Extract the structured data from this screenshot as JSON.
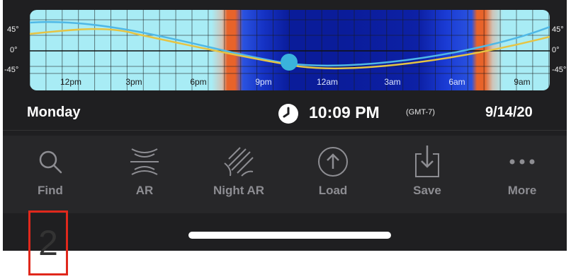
{
  "timeline": {
    "time_labels": [
      "12pm",
      "3pm",
      "6pm",
      "9pm",
      "12am",
      "3am",
      "6am",
      "9am"
    ],
    "altitude_labels_left": [
      "45°",
      "0°",
      "-45°"
    ],
    "altitude_labels_right": [
      "45°",
      "0°",
      "-45°"
    ],
    "colors": {
      "day": "#a8ecf5",
      "twilight_orange": "#e8632a",
      "night_dark": "#0a1c9a",
      "sun_line": "#4fb8e6",
      "moon_line": "#e6c443",
      "cursor": "#3ab3dc"
    }
  },
  "info": {
    "day": "Monday",
    "time": "10:09 PM",
    "timezone": "(GMT-7)",
    "date": "9/14/20"
  },
  "toolbar": {
    "items": [
      {
        "label": "Find",
        "icon": "search-icon"
      },
      {
        "label": "AR",
        "icon": "ar-icon"
      },
      {
        "label": "Night AR",
        "icon": "night-ar-icon"
      },
      {
        "label": "Load",
        "icon": "upload-icon"
      },
      {
        "label": "Save",
        "icon": "download-icon"
      },
      {
        "label": "More",
        "icon": "more-icon"
      }
    ],
    "label_color": "#8d8d92"
  },
  "annotation": {
    "page_number": "2",
    "border_color": "#e0281c"
  }
}
